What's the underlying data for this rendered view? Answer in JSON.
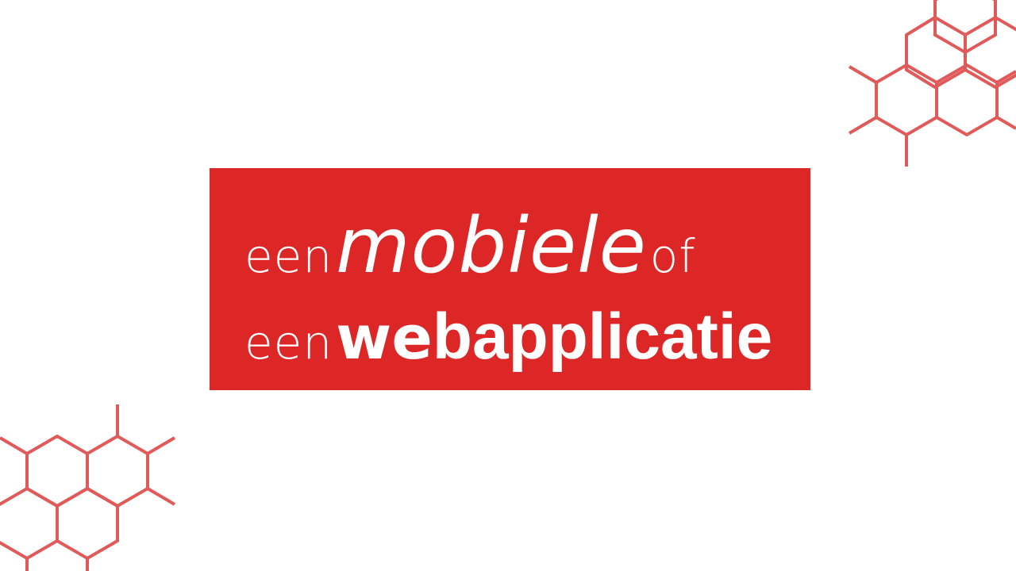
{
  "slide": {
    "line1": {
      "word1": "een",
      "word2": "mobiele",
      "word3": "of"
    },
    "line2": {
      "word1": "een",
      "word2a": "we",
      "word2b": "bapplicatie"
    }
  },
  "colors": {
    "background": "#ffffff",
    "banner": "#dd2626",
    "hexagon_stroke": "#e05a5a",
    "text": "#ffffff"
  },
  "decorations": {
    "top_right": "hexagon-pattern",
    "bottom_left": "hexagon-pattern"
  }
}
